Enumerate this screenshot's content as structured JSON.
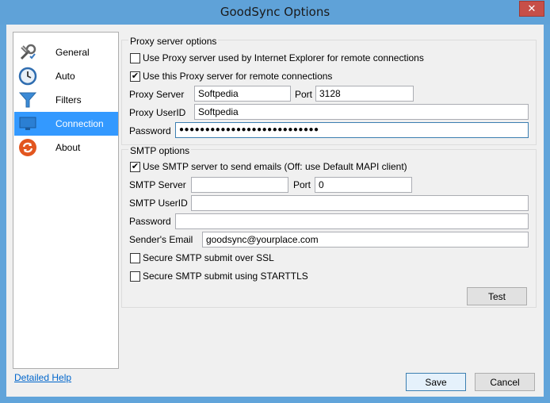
{
  "window": {
    "title": "GoodSync Options",
    "close_glyph": "✕"
  },
  "sidebar": {
    "items": [
      {
        "label": "General",
        "icon": "tools-icon",
        "selected": false
      },
      {
        "label": "Auto",
        "icon": "clock-icon",
        "selected": false
      },
      {
        "label": "Filters",
        "icon": "funnel-icon",
        "selected": false
      },
      {
        "label": "Connection",
        "icon": "monitor-icon",
        "selected": true
      },
      {
        "label": "About",
        "icon": "sync-icon",
        "selected": false
      }
    ]
  },
  "proxy": {
    "group_label": "Proxy server options",
    "use_ie_label": "Use Proxy server used by Internet Explorer for remote connections",
    "use_ie_checked": false,
    "use_this_label": "Use this Proxy server for remote connections",
    "use_this_checked": true,
    "server_label": "Proxy Server",
    "server_value": "Softpedia",
    "port_label": "Port",
    "port_value": "3128",
    "userid_label": "Proxy UserID",
    "userid_value": "Softpedia",
    "password_label": "Password",
    "password_value": "●●●●●●●●●●●●●●●●●●●●●●●●●●●"
  },
  "smtp": {
    "group_label": "SMTP options",
    "use_smtp_label": "Use SMTP server to send emails (Off: use Default MAPI client)",
    "use_smtp_checked": true,
    "server_label": "SMTP Server",
    "server_value": "",
    "port_label": "Port",
    "port_value": "0",
    "userid_label": "SMTP UserID",
    "userid_value": "",
    "password_label": "Password",
    "password_value": "",
    "sender_label": "Sender's Email",
    "sender_value": "goodsync@yourplace.com",
    "ssl_label": "Secure SMTP submit over SSL",
    "ssl_checked": false,
    "starttls_label": "Secure SMTP submit using STARTTLS",
    "starttls_checked": false,
    "test_label": "Test"
  },
  "footer": {
    "help_link": "Detailed Help",
    "save_label": "Save",
    "cancel_label": "Cancel"
  },
  "check_glyph": "✔"
}
